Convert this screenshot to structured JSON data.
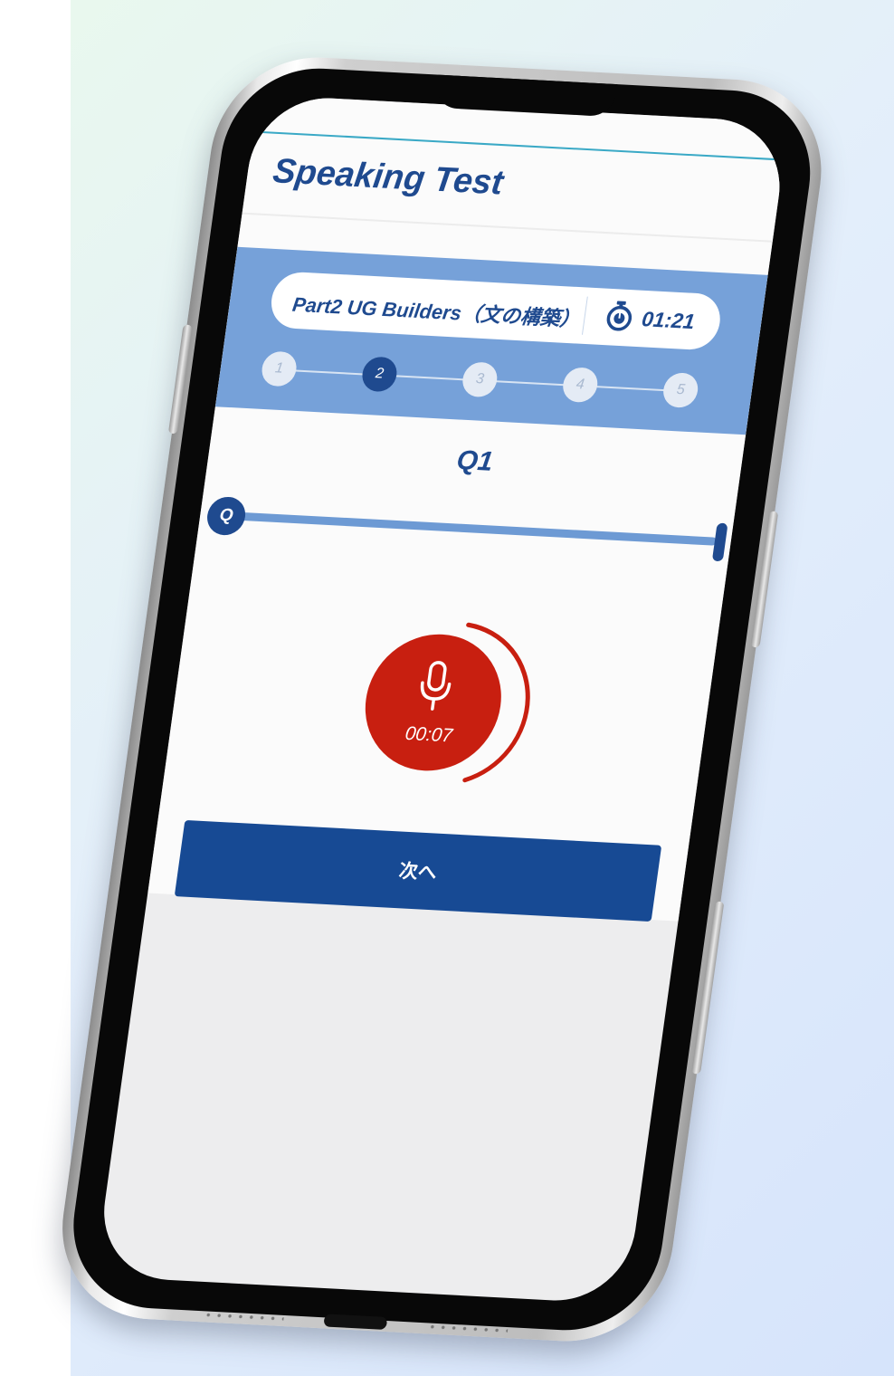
{
  "app": {
    "title": "Speaking Test"
  },
  "part": {
    "name": "Part2 UG Builders（文の構築）",
    "timer": "01:21",
    "steps": [
      {
        "label": "1",
        "active": false
      },
      {
        "label": "2",
        "active": true
      },
      {
        "label": "3",
        "active": false
      },
      {
        "label": "4",
        "active": false
      },
      {
        "label": "5",
        "active": false
      }
    ]
  },
  "question": {
    "label": "Q1",
    "progress_marker": "Q"
  },
  "recording": {
    "time": "00:07"
  },
  "actions": {
    "next_label": "次へ"
  },
  "colors": {
    "brand_navy": "#1f4a8f",
    "panel_blue": "#76a1d9",
    "record_red": "#c81f10",
    "button_blue": "#174a94"
  },
  "icons": {
    "timer": "stopwatch-icon",
    "record": "microphone-icon"
  }
}
